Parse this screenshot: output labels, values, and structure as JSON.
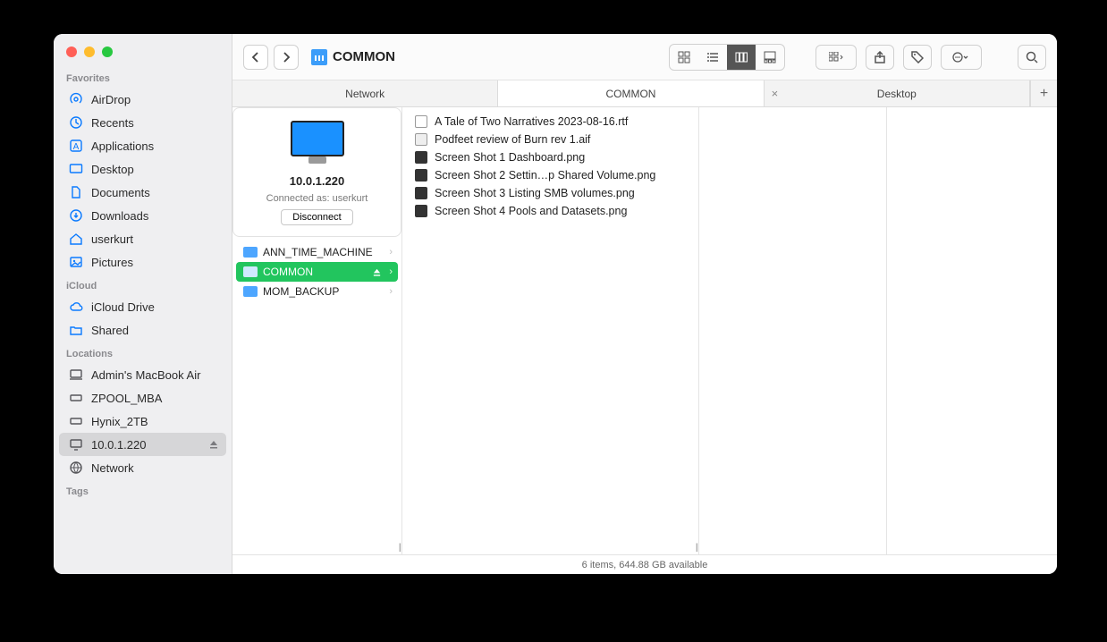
{
  "window_title": "COMMON",
  "sidebar": {
    "sections": {
      "favorites": {
        "label": "Favorites",
        "items": [
          {
            "label": "AirDrop"
          },
          {
            "label": "Recents"
          },
          {
            "label": "Applications"
          },
          {
            "label": "Desktop"
          },
          {
            "label": "Documents"
          },
          {
            "label": "Downloads"
          },
          {
            "label": "userkurt"
          },
          {
            "label": "Pictures"
          }
        ]
      },
      "icloud": {
        "label": "iCloud",
        "items": [
          {
            "label": "iCloud Drive"
          },
          {
            "label": "Shared"
          }
        ]
      },
      "locations": {
        "label": "Locations",
        "items": [
          {
            "label": "Admin's MacBook Air"
          },
          {
            "label": "ZPOOL_MBA"
          },
          {
            "label": "Hynix_2TB"
          },
          {
            "label": "10.0.1.220"
          },
          {
            "label": "Network"
          }
        ]
      },
      "tags": {
        "label": "Tags"
      }
    }
  },
  "tabs": [
    {
      "label": "Network",
      "active": false
    },
    {
      "label": "COMMON",
      "active": true
    },
    {
      "label": "Desktop",
      "active": false,
      "closable": true
    }
  ],
  "server": {
    "name": "10.0.1.220",
    "connected_as": "Connected as: userkurt",
    "disconnect_label": "Disconnect"
  },
  "shares": [
    {
      "label": "ANN_TIME_MACHINE",
      "selected": false
    },
    {
      "label": "COMMON",
      "selected": true,
      "ejectable": true
    },
    {
      "label": "MOM_BACKUP",
      "selected": false
    }
  ],
  "files": [
    {
      "label": "A Tale of Two Narratives 2023-08-16.rtf",
      "kind": "doc"
    },
    {
      "label": "Podfeet review of Burn rev 1.aif",
      "kind": "aud"
    },
    {
      "label": "Screen Shot 1 Dashboard.png",
      "kind": "img"
    },
    {
      "label": "Screen Shot 2 Settin…p Shared Volume.png",
      "kind": "img"
    },
    {
      "label": "Screen Shot 3 Listing SMB volumes.png",
      "kind": "img"
    },
    {
      "label": "Screen Shot 4 Pools and Datasets.png",
      "kind": "img"
    }
  ],
  "status_bar": "6 items, 644.88 GB available"
}
